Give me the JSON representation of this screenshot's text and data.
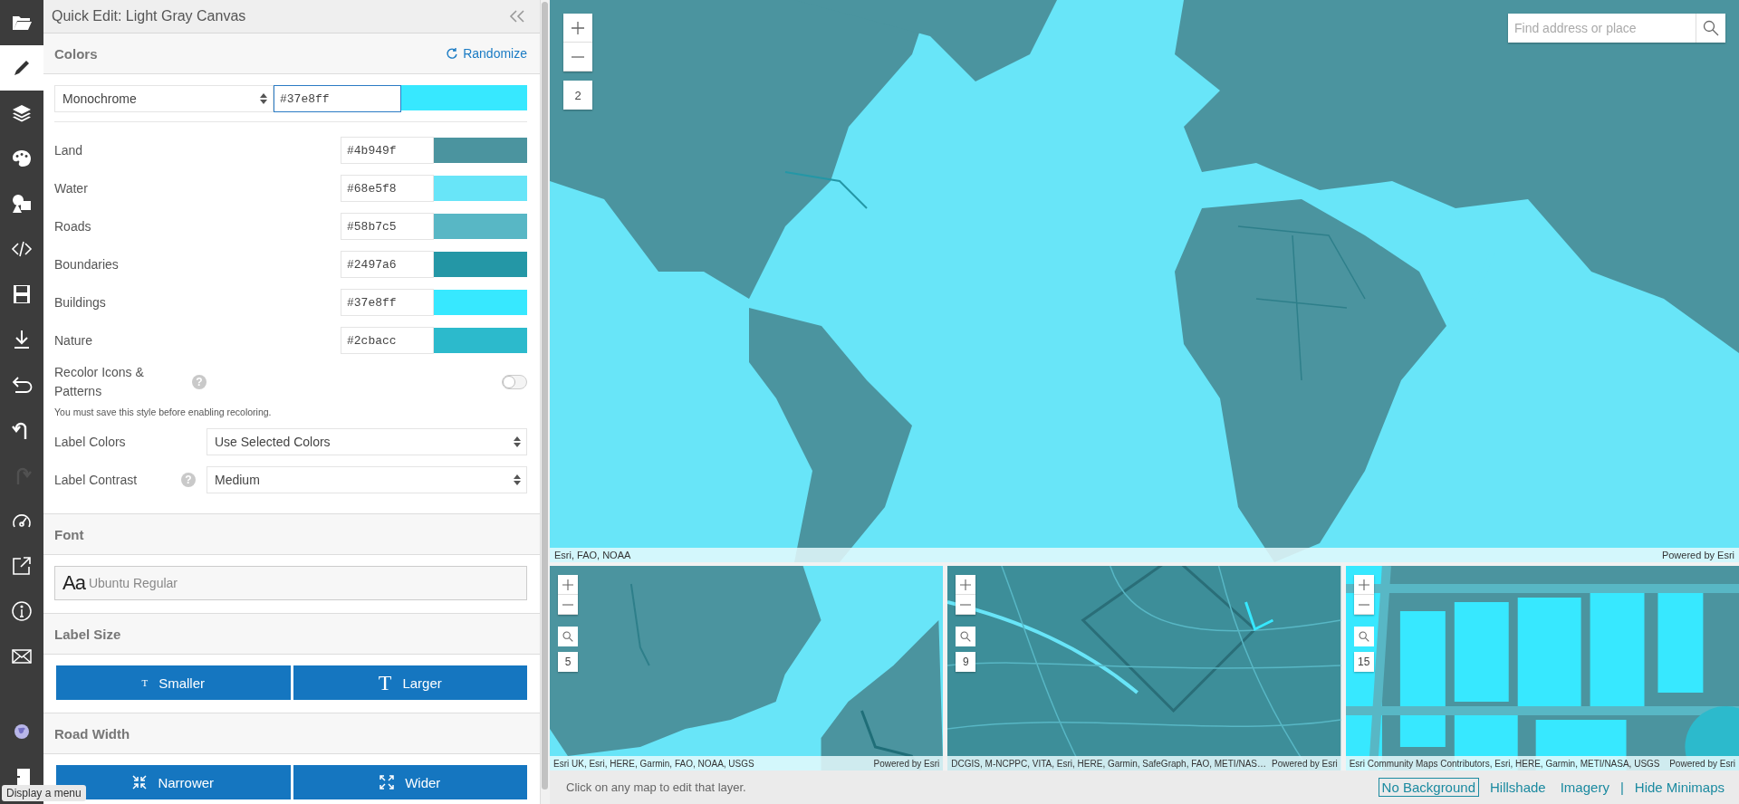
{
  "rail": [
    {
      "kind": "folder",
      "selected": false,
      "disabled": false
    },
    {
      "kind": "pencil",
      "selected": true,
      "disabled": false
    },
    {
      "kind": "layers",
      "selected": false,
      "disabled": false
    },
    {
      "kind": "palette",
      "selected": false,
      "disabled": false
    },
    {
      "kind": "shapes",
      "selected": false,
      "disabled": false
    },
    {
      "kind": "code",
      "selected": false,
      "disabled": false
    },
    {
      "kind": "save",
      "selected": false,
      "disabled": false
    },
    {
      "kind": "download",
      "selected": false,
      "disabled": false
    },
    {
      "kind": "return",
      "selected": false,
      "disabled": false
    },
    {
      "kind": "undo",
      "selected": false,
      "disabled": false
    },
    {
      "kind": "redo",
      "selected": false,
      "disabled": true
    },
    {
      "kind": "gauge",
      "selected": false,
      "disabled": false
    },
    {
      "kind": "external",
      "selected": false,
      "disabled": false
    },
    {
      "kind": "info",
      "selected": false,
      "disabled": false
    },
    {
      "kind": "mail",
      "selected": false,
      "disabled": false
    },
    {
      "kind": "globe",
      "selected": false,
      "disabled": false
    },
    {
      "kind": "menu",
      "selected": false,
      "disabled": false
    }
  ],
  "tooltip": "Display a menu",
  "panel": {
    "title": "Quick Edit: Light Gray Canvas"
  },
  "colors": {
    "heading": "Colors",
    "randomize": "Randomize",
    "scheme": "Monochrome",
    "base_value": "#37e8ff",
    "layers": [
      {
        "label": "Land",
        "value": "#4b949f"
      },
      {
        "label": "Water",
        "value": "#68e5f8"
      },
      {
        "label": "Roads",
        "value": "#58b7c5"
      },
      {
        "label": "Boundaries",
        "value": "#2497a6"
      },
      {
        "label": "Buildings",
        "value": "#37e8ff"
      },
      {
        "label": "Nature",
        "value": "#2cbacc"
      }
    ]
  },
  "recolor": {
    "label": "Recolor Icons & Patterns",
    "help": "?",
    "on": false,
    "note": "You must save this style before enabling recoloring."
  },
  "label_colors": {
    "label": "Label Colors",
    "value": "Use Selected Colors"
  },
  "label_contrast": {
    "label": "Label Contrast",
    "help": "?",
    "value": "Medium"
  },
  "font": {
    "heading": "Font",
    "sample": "Aa",
    "value": "Ubuntu Regular"
  },
  "label_size": {
    "heading": "Label Size",
    "buttons": [
      {
        "kind": "smaller",
        "icon": "T",
        "label": "Smaller"
      },
      {
        "kind": "larger",
        "icon": "T",
        "label": "Larger"
      }
    ]
  },
  "road_width": {
    "heading": "Road Width",
    "buttons": [
      {
        "kind": "narrower",
        "label": "Narrower"
      },
      {
        "kind": "wider",
        "label": "Wider"
      }
    ]
  },
  "map": {
    "zoom": "2",
    "search_placeholder": "Find address or place",
    "attribution": "Esri, FAO, NOAA",
    "powered": "Powered by Esri"
  },
  "minimaps": [
    {
      "kind": "coast",
      "zoom": "5",
      "attribution": "Esri UK, Esri, HERE, Garmin, FAO, NOAA, USGS",
      "powered": "Powered by Esri"
    },
    {
      "kind": "roads",
      "zoom": "9",
      "attribution": "DCGIS, M-NCPPC, VITA, Esri, HERE, Garmin, SafeGraph, FAO, METI/NAS…",
      "powered": "Powered by Esri"
    },
    {
      "kind": "city",
      "zoom": "15",
      "attribution": "Esri Community Maps Contributors, Esri, HERE, Garmin, METI/NASA, USGS",
      "powered": "Powered by Esri"
    }
  ],
  "status": "Click on any map to edit that layer.",
  "basemaps": [
    {
      "label": "No Background",
      "selected": true
    },
    {
      "label": "Hillshade",
      "selected": false
    },
    {
      "label": "Imagery",
      "selected": false
    }
  ],
  "separator": "|",
  "hide_minimaps": "Hide Minimaps"
}
